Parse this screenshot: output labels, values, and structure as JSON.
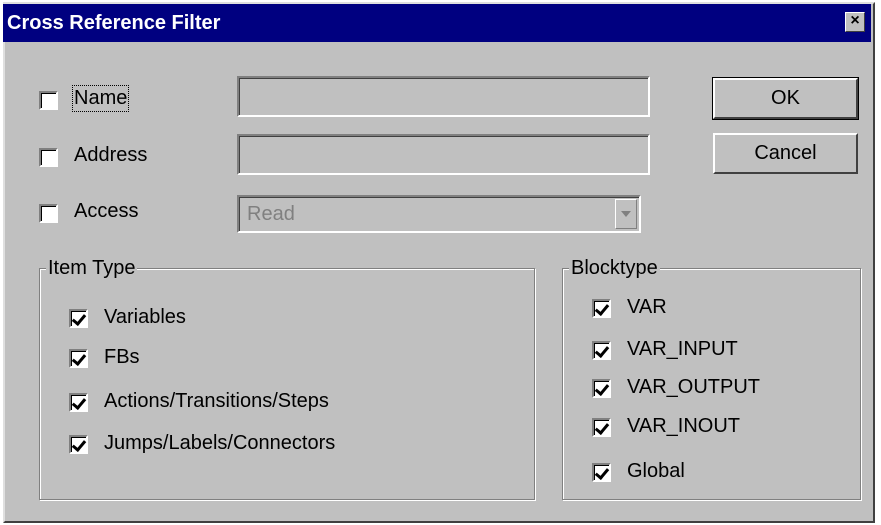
{
  "dialog": {
    "title": "Cross Reference Filter",
    "close_label": "×"
  },
  "filters": {
    "name": {
      "label": "Name",
      "checked": false,
      "value": ""
    },
    "address": {
      "label": "Address",
      "checked": false,
      "value": ""
    },
    "access": {
      "label": "Access",
      "checked": false,
      "selected": "Read"
    }
  },
  "buttons": {
    "ok": "OK",
    "cancel": "Cancel"
  },
  "item_type": {
    "title": "Item Type",
    "items": [
      {
        "label": "Variables",
        "checked": true
      },
      {
        "label": "FBs",
        "checked": true
      },
      {
        "label": "Actions/Transitions/Steps",
        "checked": true
      },
      {
        "label": "Jumps/Labels/Connectors",
        "checked": true
      }
    ]
  },
  "blocktype": {
    "title": "Blocktype",
    "items": [
      {
        "label": "VAR",
        "checked": true
      },
      {
        "label": "VAR_INPUT",
        "checked": true
      },
      {
        "label": "VAR_OUTPUT",
        "checked": true
      },
      {
        "label": "VAR_INOUT",
        "checked": true
      },
      {
        "label": "Global",
        "checked": true
      }
    ]
  }
}
